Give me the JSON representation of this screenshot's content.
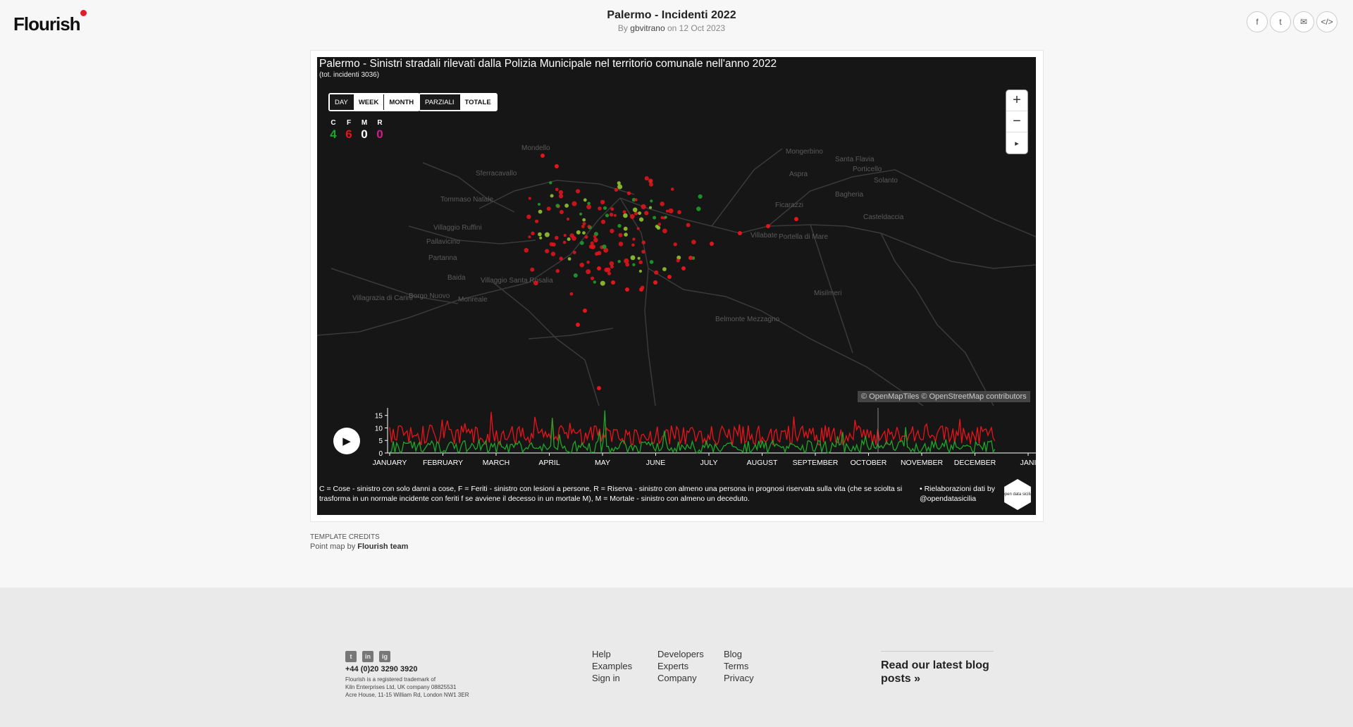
{
  "header": {
    "logo": "Flourish",
    "title": "Palermo - Incidenti 2022",
    "by": "By",
    "author": "gbvitrano",
    "on": "on 12 Oct 2023",
    "share": [
      "f",
      "t",
      "✉",
      "</>"
    ]
  },
  "viz": {
    "title": "Palermo - Sinistri stradali rilevati dalla Polizia Municipale nel territorio comunale nell'anno 2022",
    "subtitle": "(tot. incidenti 3036)",
    "period_buttons": [
      "DAY",
      "WEEK",
      "MONTH"
    ],
    "period_selected": "DAY",
    "mode_buttons": [
      "PARZIALI",
      "TOTALE"
    ],
    "mode_selected": "TOTALE",
    "legend": [
      {
        "key": "C",
        "value": "4",
        "color": "#1fa52a"
      },
      {
        "key": "F",
        "value": "6",
        "color": "#e8141b"
      },
      {
        "key": "M",
        "value": "0",
        "color": "#ffffff"
      },
      {
        "key": "R",
        "value": "0",
        "color": "#d41c8c"
      }
    ],
    "zoom_in": "+",
    "zoom_out": "−",
    "reset": "▸",
    "attribution": "© OpenMapTiles © OpenStreetMap contributors",
    "place_labels": [
      "Mondello",
      "Sferracavallo",
      "Tommaso Natale",
      "Villaggio Ruffini",
      "Pallavicino",
      "Partanna",
      "Baida",
      "Borgo Nuovo",
      "Villaggio Santa Rosalia",
      "Villagrazia di Carini",
      "Monreale",
      "Belmonte Mezzagno",
      "Bagheria",
      "Ficarazzi",
      "Villabate",
      "Misilmeri",
      "Casteldaccia",
      "Aspra",
      "Santa Flavia",
      "Porticello",
      "Solanto",
      "Mongerbino",
      "Portella di Mare"
    ],
    "play_icon": "▶",
    "footnote": "C = Cose - sinistro con solo danni a cose, F = Feriti - sinistro con lesioni a persone, R = Riserva - sinistro con almeno una persona in prognosi riservata sulla vita (che se sciolta si trasforma in un normale incidente con feriti f se avviene il decesso in un mortale M), M = Mortale - sinistro con almeno un deceduto.",
    "credit": "• Rielaborazioni dati by @opendatasicilia",
    "badge_text": "open data sicilia"
  },
  "chart_data": {
    "type": "line",
    "x_labels": [
      "JANUARY",
      "FEBRUARY",
      "MARCH",
      "APRIL",
      "MAY",
      "JUNE",
      "JULY",
      "AUGUST",
      "SEPTEMBER",
      "OCTOBER",
      "NOVEMBER",
      "DECEMBER",
      "JANI"
    ],
    "yticks": [
      0,
      5,
      10,
      15
    ],
    "ylim": [
      0,
      18
    ],
    "series": [
      {
        "name": "F",
        "color": "#e8141b"
      },
      {
        "name": "C",
        "color": "#1fa52a"
      }
    ],
    "note": "daily incident counts Jan 1 – Dec 13 2022, values 0-17"
  },
  "template_credits": {
    "label": "TEMPLATE CREDITS",
    "line": "Point map by",
    "team": "Flourish team"
  },
  "footer": {
    "social": [
      "t",
      "in",
      "ig"
    ],
    "phone": "+44 (0)20 3290 3920",
    "legal1": "Flourish is a registered trademark of",
    "legal2": "Kiln Enterprises Ltd, UK company 08825531",
    "legal3": "Acre House, 11-15 William Rd, London NW1 3ER",
    "col1": [
      "Help",
      "Examples",
      "Sign in"
    ],
    "col2": [
      "Developers",
      "Experts",
      "Company"
    ],
    "col3": [
      "Blog",
      "Terms",
      "Privacy"
    ],
    "blog": "Read our latest blog posts »"
  }
}
